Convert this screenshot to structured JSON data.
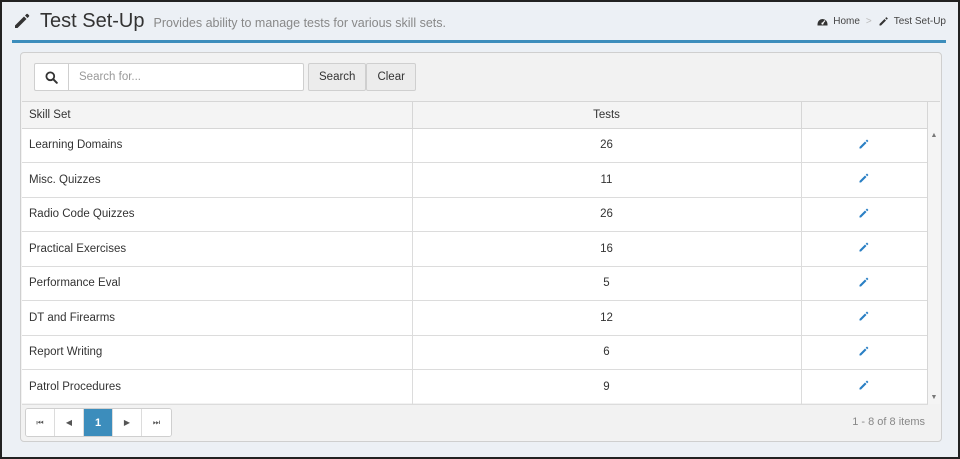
{
  "header": {
    "title": "Test Set-Up",
    "subtitle": "Provides ability to manage tests for various skill sets.",
    "breadcrumb": [
      {
        "label": "Home",
        "icon": "dashboard-icon"
      },
      {
        "label": "Test Set-Up",
        "icon": "pencil-icon"
      }
    ],
    "separator": ">"
  },
  "toolbar": {
    "search_placeholder": "Search for...",
    "search_value": "",
    "search_label": "Search",
    "clear_label": "Clear"
  },
  "grid": {
    "columns": [
      "Skill Set",
      "Tests",
      ""
    ],
    "rows": [
      {
        "skill": "Learning Domains",
        "tests": "26"
      },
      {
        "skill": "Misc. Quizzes",
        "tests": "11"
      },
      {
        "skill": "Radio Code Quizzes",
        "tests": "26"
      },
      {
        "skill": "Practical Exercises",
        "tests": "16"
      },
      {
        "skill": "Performance Eval",
        "tests": "5"
      },
      {
        "skill": "DT and Firearms",
        "tests": "12"
      },
      {
        "skill": "Report Writing",
        "tests": "6"
      },
      {
        "skill": "Patrol Procedures",
        "tests": "9"
      }
    ]
  },
  "pager": {
    "current_page": "1",
    "first": "⏮",
    "prev": "◀",
    "next": "▶",
    "last": "⏭",
    "info": "1 - 8 of 8 items"
  },
  "colors": {
    "accent": "#3c8dbc",
    "edit_icon": "#2a7fc4"
  }
}
